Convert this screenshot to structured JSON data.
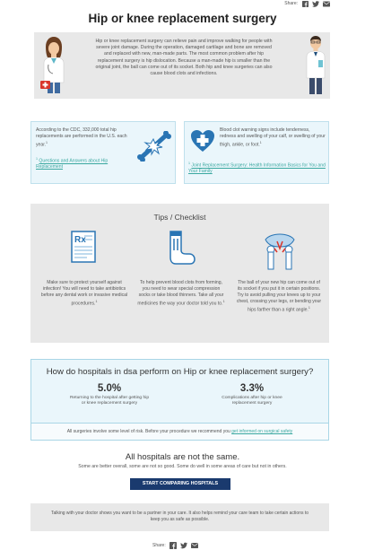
{
  "share": {
    "label": "Share:",
    "icons": [
      "facebook-icon",
      "twitter-icon",
      "email-icon"
    ]
  },
  "title": "Hip or knee replacement surgery",
  "intro": {
    "text": "Hip or knee replacement surgery can relieve pain and improve walking for people with severe joint damage. During the operation, damaged cartilage and bone are removed and replaced with new, man-made parts. The most common problem after hip replacement surgery is hip dislocation. Because a man-made hip is smaller than the original joint, the ball can come out of its socket. Both hip and knee surgeries can also cause blood clots and infections."
  },
  "facts": [
    {
      "text": "According to the CDC, 332,000 total hip replacements are performed in the U.S. each year.",
      "sup": "1",
      "ref_num": "1",
      "ref_link": "Questions and Answers about Hip Replacement"
    },
    {
      "text": "Blood clot warning signs include tenderness, redness and swelling of your calf, or swelling of your thigh, ankle, or foot.",
      "sup": "1",
      "ref_num": "1",
      "ref_link": "Joint Replacement Surgery: Health Information Basics for You and Your Family"
    }
  ],
  "tips": {
    "heading": "Tips / Checklist",
    "items": [
      {
        "icon": "prescription-icon",
        "text": "Make sure to protect yourself against infection! You will need to take antibiotics before any dental work or invasive medical procedures.",
        "sup": "1"
      },
      {
        "icon": "compression-sock-icon",
        "text": "To help prevent blood clots from forming, you need to wear special compression socks or take blood thinners. Take all your medicines the way your doctor told you to.",
        "sup": "1"
      },
      {
        "icon": "hip-joint-icon",
        "text": "The ball of your new hip can come out of its socket if you put it in certain positions. Try to avoid pulling your knees up to your chest, crossing your legs, or bending your hips farther than a right angle.",
        "sup": "1"
      }
    ]
  },
  "performance": {
    "heading": "How do hospitals in dsa perform on Hip or knee replacement surgery?",
    "stats": [
      {
        "value": "5.0%",
        "desc": "Returning to the hospital after getting hip or knee replacement surgery"
      },
      {
        "value": "3.3%",
        "desc": "Complications after hip or knee replacement surgery"
      }
    ],
    "note_text": "All surgeries involve some level of risk. Before your procedure we recommend you ",
    "note_link": "get informed on surgical safety"
  },
  "all_hospitals": {
    "heading": "All hospitals are not the same.",
    "sub": "Some are better overall, some are not so good. Some do well in some areas of care but not in others."
  },
  "cta_button": "START COMPARING HOSPITALS",
  "talk": "Talking with your doctor shows you want to be a partner in your care. It also helps remind your care team to take certain actions to keep you as safe as possible.",
  "colors": {
    "accent": "#3aa8a0",
    "button": "#1a3a6e",
    "panel": "#e8e8e8",
    "info": "#eaf6fb"
  }
}
